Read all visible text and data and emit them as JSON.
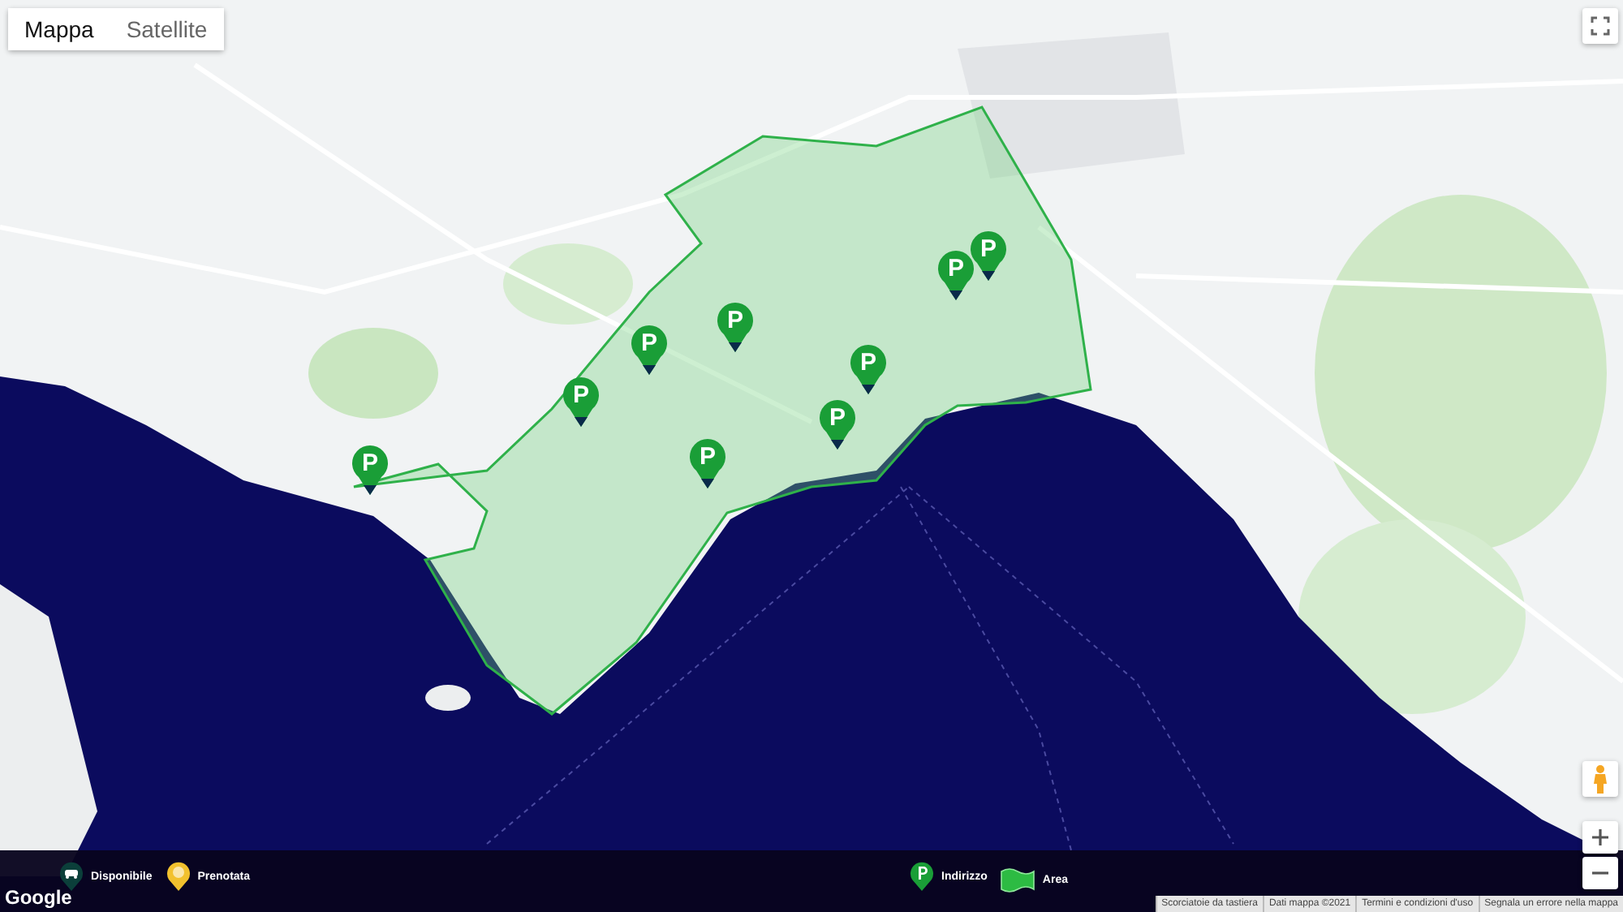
{
  "map_type_tabs": [
    {
      "label": "Mappa",
      "selected": true
    },
    {
      "label": "Satellite",
      "selected": false
    }
  ],
  "markers": [
    {
      "label": "P"
    },
    {
      "label": "P"
    },
    {
      "label": "P"
    },
    {
      "label": "P"
    },
    {
      "label": "P"
    },
    {
      "label": "P"
    },
    {
      "label": "P"
    },
    {
      "label": "P"
    },
    {
      "label": "P"
    }
  ],
  "legend": [
    {
      "kind": "available",
      "label": "Disponibile"
    },
    {
      "kind": "booked",
      "label": "Prenotata"
    },
    {
      "kind": "address",
      "label": "Indirizzo"
    },
    {
      "kind": "area",
      "label": "Area"
    }
  ],
  "google_logo": "Google",
  "attribution": [
    "Scorciatoie da tastiera",
    "Dati mappa ©2021",
    "Termini e condizioni d'uso",
    "Segnala un errore nella mappa"
  ]
}
